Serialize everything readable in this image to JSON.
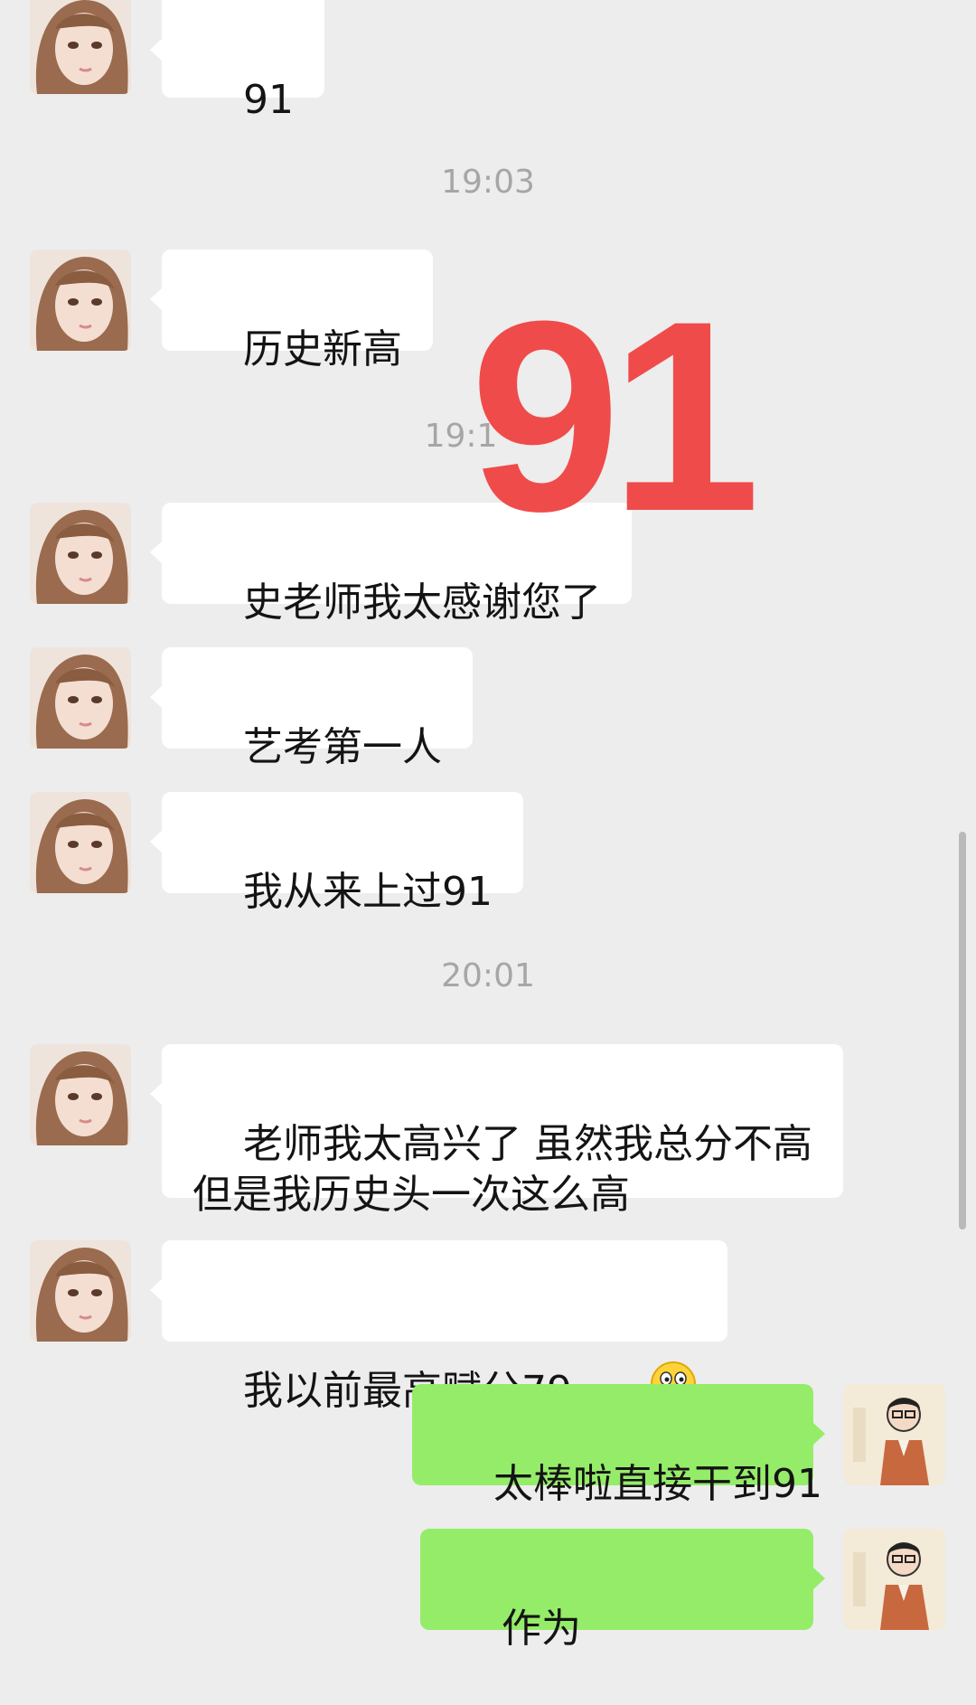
{
  "messages": [
    {
      "side": "in",
      "text": "91"
    },
    {
      "time": "19:03"
    },
    {
      "side": "in",
      "text": "历史新高"
    },
    {
      "time": "19:1"
    },
    {
      "side": "in",
      "text": "史老师我太感谢您了"
    },
    {
      "side": "in",
      "text": "艺考第一人"
    },
    {
      "side": "in",
      "text": "我从来上过91"
    },
    {
      "time": "20:01"
    },
    {
      "side": "in",
      "text": "老师我太高兴了 虽然我总分不高\n但是我历史头一次这么高"
    },
    {
      "side": "in",
      "text": "我以前最高赋分79",
      "emoji": "smile-emoji"
    },
    {
      "side": "out",
      "text": "太棒啦直接干到91"
    },
    {
      "side": "out",
      "text": "作为"
    }
  ],
  "overlay": {
    "text": "91",
    "color": "#f04b4b"
  },
  "colors": {
    "background": "#ededed",
    "incoming_bubble": "#ffffff",
    "outgoing_bubble": "#95ec69",
    "timestamp": "#a6a6a6"
  }
}
